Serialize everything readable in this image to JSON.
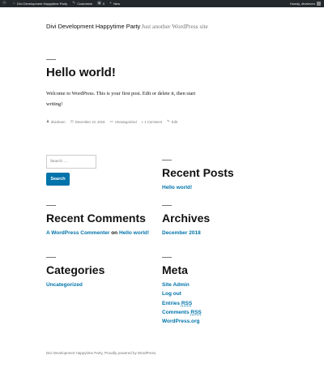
{
  "adminbar": {
    "site_name": "Divi Development Happytime Party",
    "customize": "Customize",
    "comments_count": "0",
    "new_label": "New",
    "howdy": "Howdy, divideven"
  },
  "header": {
    "site_title": "Divi Development Happytime Party",
    "separator": "—",
    "tagline": "Just another WordPress site"
  },
  "post": {
    "title": "Hello world!",
    "body": "Welcome to WordPress. This is your first post. Edit or delete it, then start writing!",
    "meta": {
      "author": "divideven",
      "date": "December 10, 2018",
      "category": "Uncategorized",
      "comments": "1 Comment",
      "edit": "Edit"
    }
  },
  "search": {
    "placeholder": "Search …",
    "button": "Search"
  },
  "widgets": {
    "recent_posts": {
      "title": "Recent Posts",
      "items": [
        "Hello world!"
      ]
    },
    "recent_comments": {
      "title": "Recent Comments",
      "author": "A WordPress Commenter",
      "on": "on",
      "post": "Hello world!"
    },
    "archives": {
      "title": "Archives",
      "items": [
        "December 2018"
      ]
    },
    "categories": {
      "title": "Categories",
      "items": [
        "Uncategorized"
      ]
    },
    "meta": {
      "title": "Meta",
      "items": [
        "Site Admin",
        "Log out"
      ],
      "entries_prefix": "Entries",
      "comments_prefix": "Comments",
      "rss": "RSS",
      "wordpress_org": "WordPress.org"
    }
  },
  "footer": {
    "text": "Divi Development Happytime Party, Proudly powered by WordPress."
  },
  "colors": {
    "accent": "#0073aa",
    "adminbar": "#23282d",
    "muted": "#767676"
  }
}
